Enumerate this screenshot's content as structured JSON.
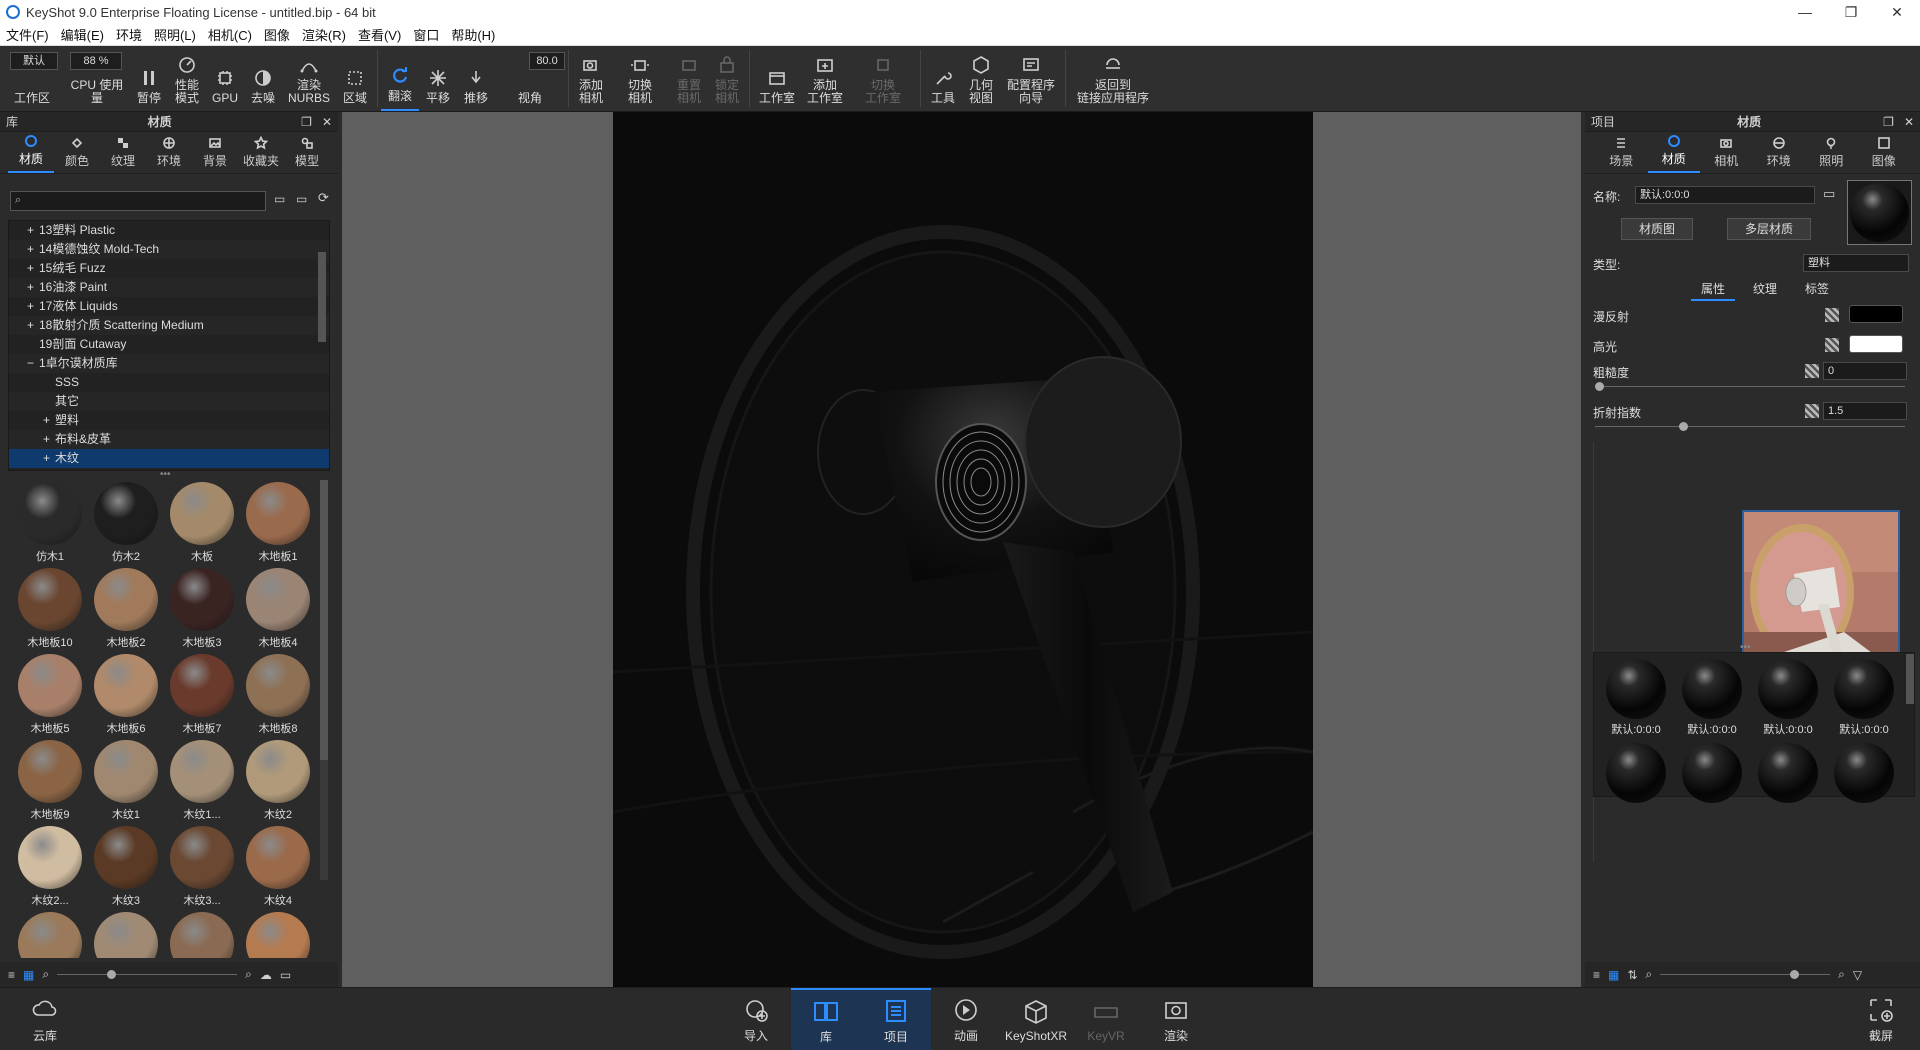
{
  "window": {
    "title": "KeyShot 9.0 Enterprise Floating License  - untitled.bip  - 64 bit"
  },
  "menu": [
    "文件(F)",
    "编辑(E)",
    "环境",
    "照明(L)",
    "相机(C)",
    "图像",
    "渲染(R)",
    "查看(V)",
    "窗口",
    "帮助(H)"
  ],
  "toolbar": {
    "workspace_select": "默认",
    "zoom_value": "88 %",
    "fov_value": "80.0",
    "workspace": "工作区",
    "cpu": "CPU 使用量",
    "pause": "暂停",
    "perf1": "性能",
    "perf2": "模式",
    "gpu": "GPU",
    "denoise": "去噪",
    "nurbs1": "渲染",
    "nurbs2": "NURBS",
    "region": "区域",
    "tumble": "翻滚",
    "pan": "平移",
    "dolly": "推移",
    "fov": "视角",
    "addcam1": "添加",
    "addcam2": "相机",
    "switchcam1": "切换",
    "switchcam2": "相机",
    "resetcam1": "重置",
    "resetcam2": "相机",
    "lockcam1": "锁定",
    "lockcam2": "相机",
    "studio": "工作室",
    "addstudio1": "添加",
    "addstudio2": "工作室",
    "switchstudio1": "切换",
    "switchstudio2": "工作室",
    "tools": "工具",
    "geo1": "几何",
    "geo2": "视图",
    "config1": "配置程序",
    "config2": "向导",
    "back1": "返回到",
    "back2": "链接应用程序"
  },
  "library": {
    "header": "库",
    "title": "材质",
    "tabs": [
      "材质",
      "颜色",
      "纹理",
      "环境",
      "背景",
      "收藏夹",
      "模型"
    ],
    "tree": [
      "13塑料 Plastic",
      "14模德蚀纹 Mold-Tech",
      "15绒毛 Fuzz",
      "16油漆 Paint",
      "17液体 Liquids",
      "18散射介质 Scattering Medium",
      "19剖面 Cutaway",
      "1卓尔谟材质库",
      "SSS",
      "其它",
      "塑料",
      "布料&皮革",
      "木纹"
    ],
    "tree_prefix": [
      "+",
      "+",
      "+",
      "+",
      "+",
      "+",
      "",
      "−",
      "",
      "",
      "+",
      "+",
      "+"
    ],
    "materials": [
      "仿木1",
      "仿木2",
      "木板",
      "木地板1",
      "木地板10",
      "木地板2",
      "木地板3",
      "木地板4",
      "木地板5",
      "木地板6",
      "木地板7",
      "木地板8",
      "木地板9",
      "木纹1",
      "木纹1...",
      "木纹2",
      "木纹2...",
      "木纹3",
      "木纹3...",
      "木纹4"
    ],
    "colors": [
      "#2a2a2a",
      "#1e1e1e",
      "#a48a6a",
      "#9a6a4c",
      "#6a4630",
      "#a07a5a",
      "#3a2422",
      "#9a8474",
      "#a8806a",
      "#b08a6a",
      "#6a3a2c",
      "#8e7054",
      "#8a6444",
      "#a08870",
      "#a49078",
      "#b09a7a",
      "#d0bca0",
      "#5a3a24",
      "#6a4832",
      "#9a6a4a",
      "#9a7a5a",
      "#a08a74",
      "#8a6a52",
      "#b47a50"
    ]
  },
  "project": {
    "header": "项目",
    "title": "材质",
    "tabs": [
      "场景",
      "材质",
      "相机",
      "环境",
      "照明",
      "图像"
    ],
    "name_label": "名称:",
    "name_value": "默认:0:0:0",
    "graph_btn": "材质图",
    "multi_btn": "多层材质",
    "type_label": "类型:",
    "type_value": "塑料",
    "subtabs": [
      "属性",
      "纹理",
      "标签"
    ],
    "diffuse": "漫反射",
    "specular": "高光",
    "roughness": "粗糙度",
    "roughness_value": "0",
    "ior": "折射指数",
    "ior_value": "1.5",
    "roughness_level": 0,
    "ior_level": 0.27,
    "diffuse_color": "#000000",
    "specular_color": "#ffffff",
    "swatches": [
      "默认:0:0:0",
      "默认:0:0:0",
      "默认:0:0:0",
      "默认:0:0:0",
      "",
      "",
      "",
      ""
    ]
  },
  "bottom": {
    "cloud": "云库",
    "import": "导入",
    "library": "库",
    "project": "项目",
    "animation": "动画",
    "xr": "KeyShotXR",
    "vr": "KeyVR",
    "render": "渲染",
    "screenshot": "截屏"
  }
}
